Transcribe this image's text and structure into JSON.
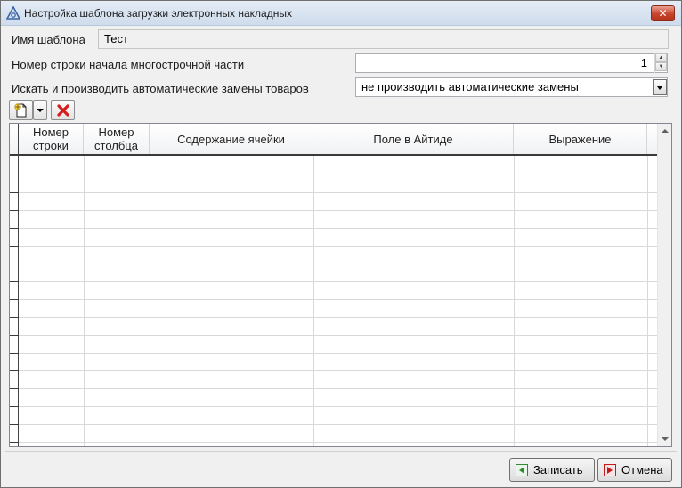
{
  "window": {
    "title": "Настройка шаблона загрузки электронных накладных"
  },
  "form": {
    "template_name_label": "Имя шаблона",
    "template_name_value": "Тест",
    "start_row_label": "Номер строки начала многострочной части",
    "start_row_value": "1",
    "auto_replace_label": "Искать и производить автоматические замены товаров",
    "auto_replace_value": "не производить автоматические замены"
  },
  "toolbar": {
    "add_icon": "add-document-icon",
    "delete_icon": "red-x-icon"
  },
  "grid": {
    "columns": [
      "Номер\nстроки",
      "Номер\nстолбца",
      "Содержание ячейки",
      "Поле в Айтиде",
      "Выражение"
    ]
  },
  "buttons": {
    "save_label": "Записать",
    "cancel_label": "Отмена"
  },
  "colors": {
    "close_button": "#c7432b",
    "delete_icon": "#d61d1d",
    "save_icon": "#2f8a2f",
    "cancel_icon": "#c41a1a"
  }
}
